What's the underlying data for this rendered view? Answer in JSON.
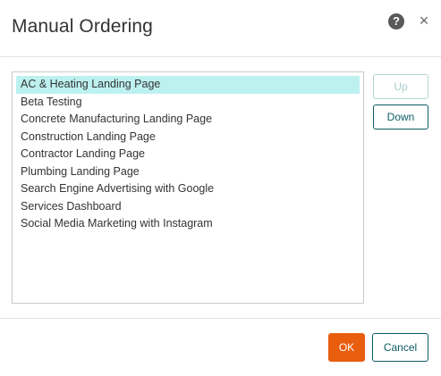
{
  "dialog": {
    "title": "Manual Ordering",
    "help_icon": "?",
    "close_icon": "×"
  },
  "list": {
    "selected_index": 0,
    "items": [
      {
        "label": "AC & Heating Landing Page"
      },
      {
        "label": "Beta Testing"
      },
      {
        "label": "Concrete Manufacturing Landing Page"
      },
      {
        "label": "Construction Landing Page"
      },
      {
        "label": "Contractor Landing Page"
      },
      {
        "label": "Plumbing Landing Page"
      },
      {
        "label": "Search Engine Advertising with Google"
      },
      {
        "label": "Services Dashboard"
      },
      {
        "label": "Social Media Marketing with Instagram"
      }
    ]
  },
  "side_buttons": {
    "up_label": "Up",
    "up_disabled": true,
    "down_label": "Down"
  },
  "footer": {
    "ok_label": "OK",
    "cancel_label": "Cancel"
  },
  "colors": {
    "selection": "#bdf1f0",
    "primary": "#e95d0f",
    "teal": "#0e5c63"
  }
}
